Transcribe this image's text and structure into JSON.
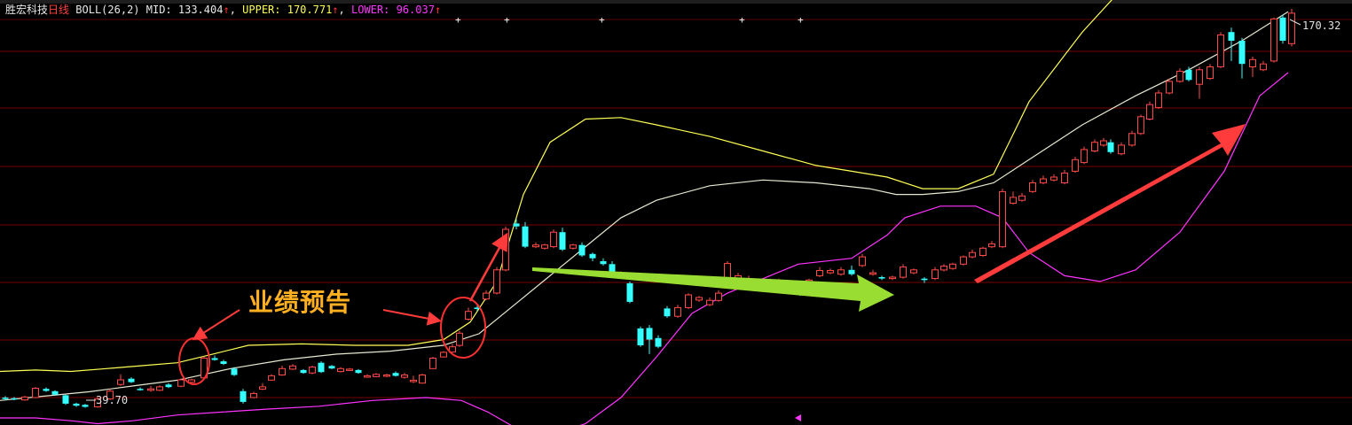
{
  "header": {
    "stock_name": "胜宏科技",
    "period": "日线",
    "indicator": "BOLL(26,2)",
    "mid_label": "MID: 133.404",
    "upper_label": "UPPER: 170.771",
    "lower_label": "LOWER: 96.037",
    "up_arrow": "↑"
  },
  "annotation": {
    "text": "业绩预告"
  },
  "labels": {
    "high": "170.32",
    "low": "39.70"
  },
  "colors": {
    "up": "#ff4a4a",
    "down": "#33ffff",
    "mid": "#e8e8d0",
    "upper": "#ffff55",
    "lower": "#ff33ff",
    "grid": "#7a0000",
    "red_arrow": "#ff3b3b",
    "green_arrow": "#99dd33"
  },
  "chart_data": {
    "type": "candlestick",
    "indicator": "BOLL(26,2)",
    "ylim": [
      35,
      178
    ],
    "mid": [
      [
        0,
        39
      ],
      [
        50,
        40.5
      ],
      [
        100,
        42
      ],
      [
        150,
        44
      ],
      [
        200,
        46
      ],
      [
        260,
        50
      ],
      [
        320,
        53
      ],
      [
        380,
        55
      ],
      [
        440,
        56
      ],
      [
        500,
        58
      ],
      [
        540,
        62
      ],
      [
        580,
        72
      ],
      [
        620,
        82
      ],
      [
        660,
        92
      ],
      [
        700,
        102
      ],
      [
        740,
        108
      ],
      [
        800,
        113
      ],
      [
        860,
        115
      ],
      [
        920,
        114
      ],
      [
        980,
        112
      ],
      [
        1010,
        110
      ],
      [
        1040,
        110
      ],
      [
        1080,
        111
      ],
      [
        1120,
        114
      ],
      [
        1160,
        122
      ],
      [
        1220,
        134
      ],
      [
        1280,
        144
      ],
      [
        1340,
        153
      ],
      [
        1400,
        163
      ],
      [
        1452,
        173
      ]
    ],
    "upper": [
      [
        0,
        49
      ],
      [
        40,
        49.5
      ],
      [
        80,
        49
      ],
      [
        120,
        50
      ],
      [
        160,
        51
      ],
      [
        200,
        52
      ],
      [
        240,
        55
      ],
      [
        280,
        58
      ],
      [
        340,
        58.5
      ],
      [
        400,
        58
      ],
      [
        460,
        58
      ],
      [
        500,
        60
      ],
      [
        530,
        66
      ],
      [
        560,
        80
      ],
      [
        590,
        110
      ],
      [
        620,
        128
      ],
      [
        660,
        136
      ],
      [
        700,
        136.5
      ],
      [
        740,
        134
      ],
      [
        800,
        130
      ],
      [
        860,
        125
      ],
      [
        920,
        120
      ],
      [
        960,
        118
      ],
      [
        1000,
        116
      ],
      [
        1040,
        112
      ],
      [
        1080,
        112
      ],
      [
        1120,
        117
      ],
      [
        1160,
        142
      ],
      [
        1220,
        166
      ],
      [
        1280,
        186
      ],
      [
        1340,
        206
      ],
      [
        1400,
        222
      ],
      [
        1452,
        240
      ]
    ],
    "lower": [
      [
        0,
        33
      ],
      [
        40,
        33
      ],
      [
        80,
        32
      ],
      [
        110,
        31
      ],
      [
        150,
        32
      ],
      [
        200,
        34
      ],
      [
        250,
        35
      ],
      [
        300,
        36
      ],
      [
        360,
        37
      ],
      [
        420,
        39
      ],
      [
        480,
        40
      ],
      [
        520,
        39
      ],
      [
        550,
        35
      ],
      [
        590,
        28
      ],
      [
        620,
        27
      ],
      [
        660,
        31
      ],
      [
        700,
        40
      ],
      [
        740,
        54
      ],
      [
        780,
        69
      ],
      [
        820,
        76
      ],
      [
        860,
        81
      ],
      [
        900,
        86
      ],
      [
        960,
        88
      ],
      [
        1000,
        96
      ],
      [
        1020,
        102
      ],
      [
        1060,
        106
      ],
      [
        1100,
        106
      ],
      [
        1130,
        102
      ],
      [
        1160,
        90
      ],
      [
        1200,
        82
      ],
      [
        1240,
        80
      ],
      [
        1280,
        84
      ],
      [
        1330,
        97
      ],
      [
        1380,
        118
      ],
      [
        1420,
        144
      ],
      [
        1452,
        152
      ]
    ],
    "candles": [
      [
        6,
        39.5,
        40.0,
        40.5,
        39.0,
        0
      ],
      [
        16,
        39.8,
        39.4,
        40.2,
        39.1,
        0
      ],
      [
        28,
        39.2,
        40.2,
        40.6,
        38.9,
        1
      ],
      [
        40,
        40.0,
        43.2,
        43.6,
        39.8,
        1
      ],
      [
        52,
        43.0,
        42.3,
        43.5,
        42.0,
        0
      ],
      [
        62,
        42.2,
        41.0,
        42.5,
        40.8,
        0
      ],
      [
        74,
        40.8,
        37.9,
        41.0,
        37.5,
        0
      ],
      [
        86,
        37.9,
        37.2,
        38.2,
        36.8,
        0
      ],
      [
        96,
        37.5,
        36.8,
        37.8,
        36.5,
        0
      ],
      [
        110,
        36.8,
        39.5,
        40.0,
        36.5,
        1
      ],
      [
        124,
        39.5,
        42.2,
        43.0,
        39.2,
        1
      ],
      [
        136,
        44.5,
        46.1,
        48.0,
        44.0,
        1
      ],
      [
        148,
        46.5,
        45.3,
        47.0,
        45.0,
        0
      ],
      [
        158,
        43.0,
        42.6,
        43.5,
        42.4,
        0
      ],
      [
        170,
        42.5,
        43.0,
        44.0,
        42.0,
        1
      ],
      [
        180,
        42.5,
        43.7,
        44.2,
        42.2,
        1
      ],
      [
        190,
        44.5,
        43.6,
        45.0,
        43.3,
        0
      ],
      [
        204,
        43.9,
        46.1,
        46.6,
        43.6,
        1
      ],
      [
        216,
        45.2,
        46.1,
        46.5,
        45.0,
        1
      ],
      [
        230,
        46.8,
        53.6,
        54.2,
        46.5,
        1
      ],
      [
        242,
        53.6,
        53.0,
        54.5,
        52.7,
        0
      ],
      [
        252,
        52.5,
        51.6,
        53.0,
        51.2,
        0
      ],
      [
        264,
        50.0,
        47.8,
        50.5,
        47.4,
        0
      ],
      [
        274,
        42.2,
        38.5,
        43.0,
        37.9,
        0
      ],
      [
        286,
        40.0,
        41.4,
        42.0,
        39.8,
        1
      ],
      [
        296,
        42.9,
        43.7,
        45.0,
        42.6,
        1
      ],
      [
        306,
        46.0,
        47.5,
        48.0,
        45.8,
        1
      ],
      [
        318,
        47.8,
        50.0,
        51.0,
        47.5,
        1
      ],
      [
        330,
        49.8,
        50.9,
        51.5,
        49.5,
        1
      ],
      [
        342,
        49.5,
        48.5,
        49.8,
        48.2,
        0
      ],
      [
        352,
        48.5,
        50.5,
        51.0,
        48.0,
        1
      ],
      [
        362,
        52.0,
        48.8,
        52.5,
        48.5,
        0
      ],
      [
        374,
        50.9,
        50.0,
        51.2,
        49.8,
        0
      ],
      [
        384,
        49.0,
        50.0,
        50.5,
        48.6,
        1
      ],
      [
        394,
        49.7,
        49.8,
        50.2,
        49.3,
        1
      ],
      [
        404,
        49.5,
        48.5,
        49.8,
        48.2,
        0
      ],
      [
        414,
        47.0,
        47.5,
        48.0,
        46.8,
        1
      ],
      [
        424,
        47.2,
        48.0,
        48.5,
        47.0,
        1
      ],
      [
        436,
        47.5,
        47.8,
        48.2,
        47.0,
        1
      ],
      [
        446,
        48.5,
        47.5,
        49.0,
        47.2,
        0
      ],
      [
        456,
        47.0,
        47.8,
        48.5,
        46.5,
        1
      ],
      [
        466,
        45.5,
        46.0,
        47.5,
        45.0,
        1
      ],
      [
        476,
        45.0,
        47.8,
        48.2,
        44.8,
        1
      ],
      [
        488,
        50.0,
        53.6,
        54.0,
        49.8,
        1
      ],
      [
        500,
        54.0,
        55.6,
        56.0,
        53.8,
        1
      ],
      [
        510,
        55.7,
        57.5,
        58.5,
        55.5,
        1
      ],
      [
        518,
        58.0,
        62.2,
        63.0,
        57.5,
        1
      ],
      [
        528,
        67.0,
        69.7,
        71.0,
        66.5,
        1
      ],
      [
        538,
        71.0,
        70.5,
        72.0,
        69.8,
        0
      ],
      [
        548,
        74.0,
        76.0,
        77.0,
        73.5,
        1
      ],
      [
        560,
        76.0,
        84.0,
        85.0,
        75.5,
        1
      ],
      [
        570,
        84.0,
        98.0,
        99.0,
        83.5,
        1
      ],
      [
        582,
        100.0,
        99.0,
        101.5,
        98.0,
        0
      ],
      [
        592,
        99.0,
        92.0,
        100.5,
        91.5,
        0
      ],
      [
        604,
        92.0,
        92.6,
        93.5,
        91.5,
        1
      ],
      [
        614,
        91.5,
        92.6,
        93.0,
        91.0,
        1
      ],
      [
        624,
        92.0,
        97.0,
        98.0,
        91.5,
        1
      ],
      [
        634,
        97.0,
        91.0,
        98.5,
        90.5,
        0
      ],
      [
        646,
        91.5,
        92.6,
        93.0,
        91.0,
        1
      ],
      [
        656,
        92.6,
        89.0,
        93.5,
        88.5,
        0
      ],
      [
        668,
        89.5,
        88.0,
        90.0,
        87.0,
        0
      ],
      [
        680,
        87.0,
        86.0,
        88.0,
        85.5,
        0
      ],
      [
        690,
        86.0,
        82.5,
        87.0,
        82.0,
        0
      ],
      [
        700,
        82.5,
        82.5,
        83.5,
        82.0,
        1
      ],
      [
        710,
        79.4,
        73.0,
        80.0,
        72.5,
        0
      ],
      [
        722,
        63.8,
        58.0,
        64.5,
        57.5,
        0
      ],
      [
        732,
        64.0,
        60.0,
        65.0,
        55.0,
        0
      ],
      [
        742,
        60.5,
        57.5,
        61.5,
        57.0,
        0
      ],
      [
        752,
        68.0,
        70.7,
        71.5,
        67.5,
        0
      ],
      [
        764,
        68.0,
        71.0,
        72.0,
        67.5,
        1
      ],
      [
        776,
        71.0,
        75.4,
        76.0,
        70.5,
        1
      ],
      [
        788,
        73.6,
        74.5,
        75.0,
        73.0,
        1
      ],
      [
        800,
        72.0,
        73.5,
        74.5,
        71.5,
        1
      ],
      [
        810,
        73.5,
        76.0,
        77.0,
        73.0,
        1
      ],
      [
        820,
        79.4,
        86.2,
        87.0,
        79.0,
        1
      ],
      [
        832,
        80.5,
        82.0,
        83.0,
        80.0,
        1
      ],
      [
        844,
        79.4,
        81.0,
        82.0,
        79.0,
        1
      ],
      [
        856,
        78.0,
        77.0,
        79.5,
        76.5,
        0
      ],
      [
        868,
        79.0,
        80.5,
        81.0,
        78.5,
        1
      ],
      [
        878,
        79.0,
        80.0,
        81.0,
        78.5,
        1
      ],
      [
        890,
        77.0,
        78.0,
        78.5,
        76.5,
        1
      ],
      [
        902,
        76.5,
        75.5,
        78.0,
        75.0,
        0
      ],
      [
        912,
        79.0,
        80.5,
        81.0,
        78.5,
        1
      ],
      [
        924,
        82.0,
        83.8,
        85.0,
        81.5,
        1
      ],
      [
        936,
        83.0,
        83.8,
        84.5,
        82.5,
        1
      ],
      [
        948,
        82.5,
        84.0,
        85.0,
        82.0,
        1
      ],
      [
        960,
        84.0,
        82.5,
        85.5,
        82.0,
        0
      ],
      [
        972,
        85.5,
        88.5,
        89.5,
        85.0,
        1
      ],
      [
        984,
        82.5,
        83.0,
        84.0,
        82.0,
        1
      ],
      [
        994,
        81.5,
        81.0,
        82.0,
        80.5,
        0
      ],
      [
        1006,
        81.0,
        81.5,
        82.0,
        80.5,
        1
      ],
      [
        1018,
        81.5,
        85.0,
        86.0,
        81.0,
        1
      ],
      [
        1030,
        83.0,
        84.0,
        84.5,
        82.5,
        1
      ],
      [
        1042,
        81.0,
        80.5,
        81.5,
        79.5,
        0
      ],
      [
        1054,
        81.0,
        84.0,
        85.0,
        80.5,
        1
      ],
      [
        1064,
        84.0,
        85.3,
        86.0,
        83.5,
        1
      ],
      [
        1074,
        84.5,
        86.0,
        86.5,
        84.0,
        1
      ],
      [
        1086,
        86.0,
        88.5,
        89.0,
        85.5,
        1
      ],
      [
        1096,
        88.5,
        90.0,
        91.0,
        88.0,
        1
      ],
      [
        1108,
        89.0,
        91.5,
        92.0,
        88.5,
        1
      ],
      [
        1118,
        92.0,
        93.0,
        94.0,
        91.5,
        1
      ],
      [
        1130,
        92.0,
        111.0,
        112.0,
        91.5,
        1
      ],
      [
        1142,
        107.0,
        109.0,
        111.0,
        106.5,
        1
      ],
      [
        1152,
        108.0,
        109.5,
        110.5,
        107.5,
        1
      ],
      [
        1164,
        111.0,
        114.0,
        115.0,
        110.5,
        1
      ],
      [
        1176,
        114.0,
        115.4,
        116.5,
        113.5,
        1
      ],
      [
        1188,
        115.0,
        116.0,
        117.0,
        114.5,
        1
      ],
      [
        1200,
        114.0,
        117.4,
        118.5,
        113.5,
        1
      ],
      [
        1212,
        118.0,
        122.0,
        123.0,
        117.5,
        1
      ],
      [
        1222,
        121.0,
        125.5,
        126.5,
        120.5,
        1
      ],
      [
        1234,
        125.0,
        128.0,
        129.0,
        124.5,
        1
      ],
      [
        1244,
        127.0,
        128.5,
        129.5,
        126.5,
        1
      ],
      [
        1252,
        128.0,
        124.6,
        129.0,
        124.0,
        0
      ],
      [
        1264,
        124.0,
        127.0,
        128.0,
        123.5,
        1
      ],
      [
        1276,
        127.0,
        131.0,
        132.0,
        126.5,
        1
      ],
      [
        1286,
        131.0,
        136.8,
        137.5,
        130.5,
        1
      ],
      [
        1296,
        136.0,
        141.0,
        142.0,
        135.5,
        1
      ],
      [
        1306,
        140.0,
        145.0,
        146.0,
        139.5,
        1
      ],
      [
        1318,
        145.0,
        149.0,
        150.0,
        144.5,
        1
      ],
      [
        1330,
        149.0,
        152.5,
        153.5,
        148.5,
        1
      ],
      [
        1340,
        153.0,
        149.5,
        154.0,
        149.0,
        0
      ],
      [
        1352,
        148.0,
        153.0,
        154.0,
        143.0,
        1
      ],
      [
        1364,
        150.0,
        154.0,
        155.0,
        149.5,
        1
      ],
      [
        1376,
        154.0,
        165.0,
        166.0,
        153.5,
        1
      ],
      [
        1388,
        166.0,
        163.0,
        167.5,
        156.0,
        0
      ],
      [
        1400,
        163.0,
        155.0,
        164.0,
        150.0,
        0
      ],
      [
        1412,
        154.0,
        156.5,
        157.5,
        150.5,
        1
      ],
      [
        1424,
        153.0,
        155.0,
        156.0,
        152.5,
        1
      ],
      [
        1436,
        156.0,
        170.5,
        171.0,
        155.5,
        1
      ],
      [
        1446,
        171.0,
        163.0,
        172.0,
        162.0,
        0
      ],
      [
        1456,
        162.0,
        172.5,
        174.0,
        161.0,
        1
      ]
    ]
  }
}
